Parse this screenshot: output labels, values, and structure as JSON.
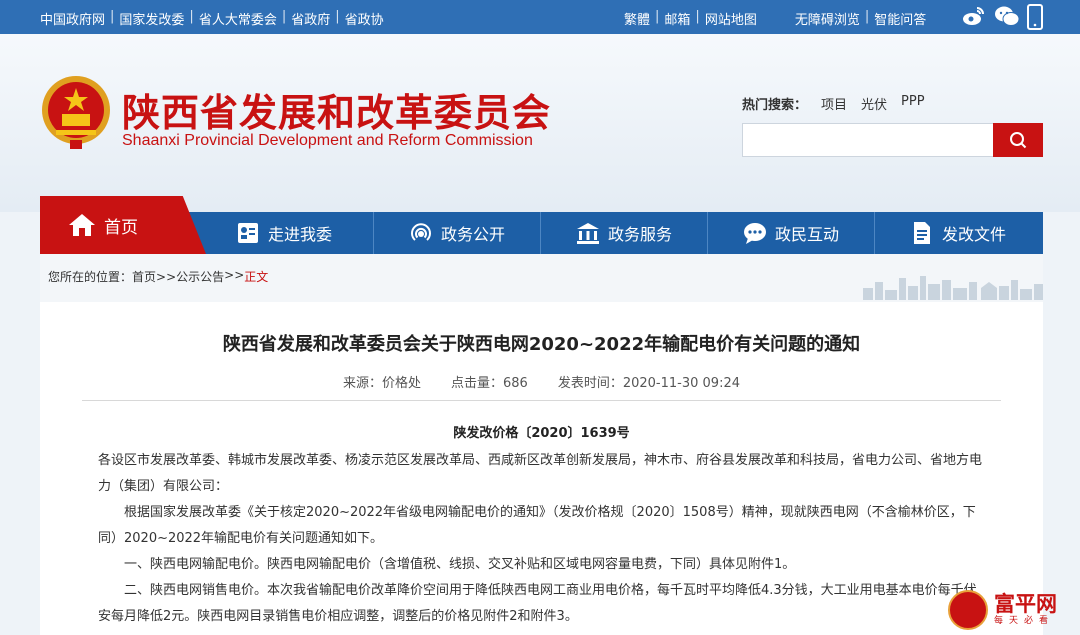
{
  "topbar": {
    "left_links": [
      "中国政府网",
      "国家发改委",
      "省人大常委会",
      "省政府",
      "省政协"
    ],
    "right_links_1": [
      "繁體",
      "邮箱",
      "网站地图"
    ],
    "right_links_2": [
      "无障碍浏览",
      "智能问答"
    ],
    "icons": [
      "weibo-icon",
      "wechat-icon",
      "mobile-icon"
    ]
  },
  "header": {
    "title": "陕西省发展和改革委员会",
    "subtitle": "Shaanxi Provincial Development and Reform Commission",
    "hot_label": "热门搜索：",
    "hot_keywords": [
      "项目",
      "光伏",
      "PPP"
    ],
    "search_placeholder": ""
  },
  "nav": {
    "home": "首页",
    "items": [
      {
        "label": "走进我委",
        "icon": "profile-card-icon"
      },
      {
        "label": "政务公开",
        "icon": "broadcast-icon"
      },
      {
        "label": "政务服务",
        "icon": "building-icon"
      },
      {
        "label": "政民互动",
        "icon": "chat-bubble-icon"
      },
      {
        "label": "发改文件",
        "icon": "document-icon"
      }
    ]
  },
  "breadcrumb": {
    "prefix": "您所在的位置：",
    "items": [
      "首页",
      ">>公示公告",
      ">>"
    ],
    "current": "正文"
  },
  "article": {
    "title": "陕西省发展和改革委员会关于陕西电网2020~2022年输配电价有关问题的通知",
    "source": "来源：价格处",
    "clicks": "点击量：686",
    "published": "发表时间：2020-11-30 09:24",
    "doc_number": "陕发改价格〔2020〕1639号",
    "paragraphs": [
      "各设区市发展改革委、韩城市发展改革委、杨凌示范区发展改革局、西咸新区改革创新发展局，神木市、府谷县发展改革和科技局，省电力公司、省地方电力（集团）有限公司：",
      "根据国家发展改革委《关于核定2020~2022年省级电网输配电价的通知》（发改价格规〔2020〕1508号）精神，现就陕西电网（不含榆林价区，下同）2020~2022年输配电价有关问题通知如下。",
      "一、陕西电网输配电价。陕西电网输配电价（含增值税、线损、交叉补贴和区域电网容量电费，下同）具体见附件1。",
      "二、陕西电网销售电价。本次我省输配电价改革降价空间用于降低陕西电网工商业用电价格，每千瓦时平均降低4.3分钱，大工业用电基本电价每千伏安每月降低2元。陕西电网目录销售电价相应调整，调整后的价格见附件2和附件3。"
    ]
  },
  "watermark": {
    "name": "富平网",
    "slogan": "每天必看"
  },
  "colors": {
    "topbar": "#2f6fb5",
    "nav": "#1d5fa6",
    "accent": "#c81212"
  }
}
